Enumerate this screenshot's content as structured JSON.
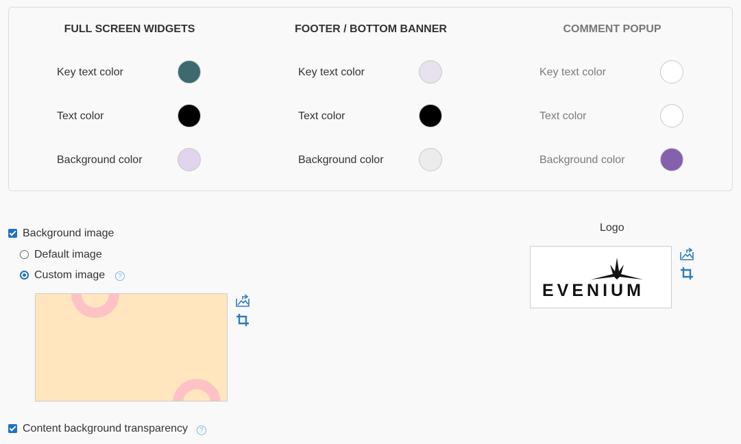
{
  "colors_panel": {
    "columns": [
      {
        "title": "FULL SCREEN WIDGETS",
        "rows": [
          {
            "label": "Key text color",
            "color": "#3d6a6e"
          },
          {
            "label": "Text color",
            "color": "#000000"
          },
          {
            "label": "Background color",
            "color": "#e2d4ec"
          }
        ]
      },
      {
        "title": "FOOTER / BOTTOM BANNER",
        "rows": [
          {
            "label": "Key text color",
            "color": "#e8e1ee"
          },
          {
            "label": "Text color",
            "color": "#000000"
          },
          {
            "label": "Background color",
            "color": "#ececec"
          }
        ]
      },
      {
        "title": "COMMENT POPUP",
        "rows": [
          {
            "label": "Key text color",
            "color": "#ffffff"
          },
          {
            "label": "Text color",
            "color": "#ffffff"
          },
          {
            "label": "Background color",
            "color": "#8460ad"
          }
        ]
      }
    ]
  },
  "background_image": {
    "label": "Background image",
    "checked": true,
    "options": [
      {
        "label": "Default image",
        "selected": false
      },
      {
        "label": "Custom image",
        "selected": true
      }
    ],
    "help_icon": "question-circle-icon",
    "preview_colors": {
      "fill": "#ffe6bf",
      "ring": "#ffc2c4"
    }
  },
  "content_transparency": {
    "label": "Content background transparency",
    "checked": true
  },
  "logo": {
    "label": "Logo",
    "brand_text": "EVENIUM"
  },
  "icons": {
    "upload": "image-upload-icon",
    "crop": "crop-icon"
  },
  "accent_color": "#1a73c8"
}
